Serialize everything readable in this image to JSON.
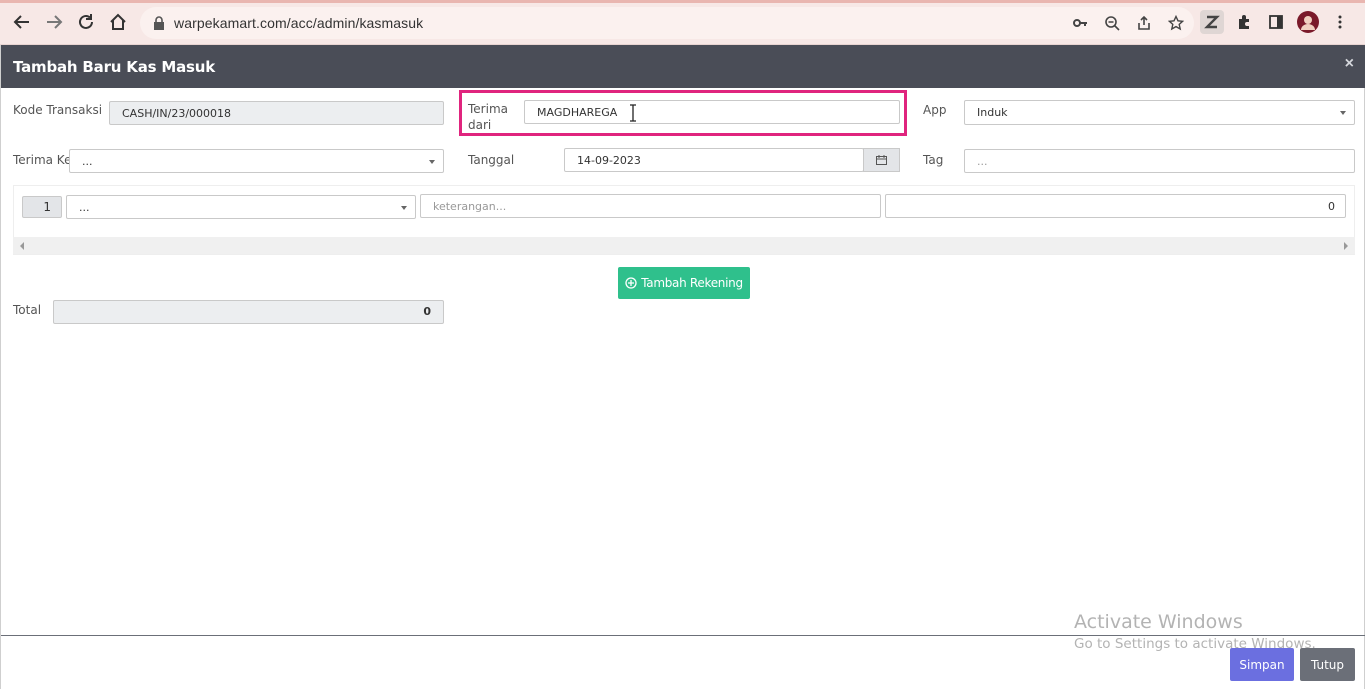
{
  "browser": {
    "url": "warpekamart.com/acc/admin/kasmasuk",
    "icons": [
      "back-arrow-icon",
      "forward-arrow-icon",
      "reload-icon",
      "home-icon",
      "lock-icon",
      "key-icon",
      "zoom-out-icon",
      "share-icon",
      "star-icon",
      "extension-z-icon",
      "puzzle-icon",
      "side-panel-icon",
      "profile-avatar",
      "kebab-menu-icon"
    ]
  },
  "modal": {
    "title": "Tambah Baru Kas Masuk",
    "close_glyph": "×"
  },
  "form": {
    "kode_transaksi_label": "Kode Transaksi",
    "kode_transaksi_value": "CASH/IN/23/000018",
    "terima_dari_label_1": "Terima",
    "terima_dari_label_2": "dari",
    "terima_dari_value": "MAGDHAREGA",
    "app_label": "App",
    "app_value": "Induk",
    "terima_ke_label": "Terima Ke",
    "terima_ke_value": "...",
    "tanggal_label": "Tanggal",
    "tanggal_value": "14-09-2023",
    "tag_label": "Tag",
    "tag_placeholder": "..."
  },
  "rows": [
    {
      "number": "1",
      "account": "...",
      "keterangan_placeholder": "keterangan...",
      "amount": "0"
    }
  ],
  "actions": {
    "add_account_label": "Tambah Rekening",
    "total_label": "Total",
    "total_value": "0",
    "save_label": "Simpan",
    "close_label": "Tutup"
  },
  "watermark": {
    "title": "Activate Windows",
    "subtitle": "Go to Settings to activate Windows."
  },
  "colors": {
    "header_bg": "#4a4d57",
    "highlight": "#e0247e",
    "add_button": "#2fc08c",
    "save_button": "#6b6fe0",
    "close_button": "#6b6f78"
  }
}
